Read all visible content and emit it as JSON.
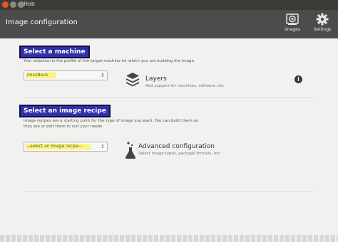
{
  "window": {
    "title": "Hob"
  },
  "header": {
    "title": "Image configuration",
    "tools": [
      {
        "label": "Images",
        "icon": "images-icon"
      },
      {
        "label": "Settings",
        "icon": "gear-icon"
      }
    ]
  },
  "machine": {
    "heading": "Select a machine",
    "description": "Your selection is the profile of the target machine for which you are building the image.",
    "selected": "imx28evk"
  },
  "layers": {
    "title": "Layers",
    "subtitle": "Add support for machines, software, etc."
  },
  "recipe": {
    "heading": "Select an image recipe",
    "description_line1": "Image recipes are a starting point for the type of image you want. You can build them as",
    "description_line2": "they are or edit them to suit your needs.",
    "selected": "--select an image recipe--"
  },
  "advanced": {
    "title": "Advanced configuration",
    "subtitle": "Select image types, package formats, etc"
  },
  "colors": {
    "header_bg": "#4c4c4c",
    "heading_bg": "#3030aa",
    "highlight": "#fbf57a",
    "window_bg": "#f2f1f0"
  }
}
